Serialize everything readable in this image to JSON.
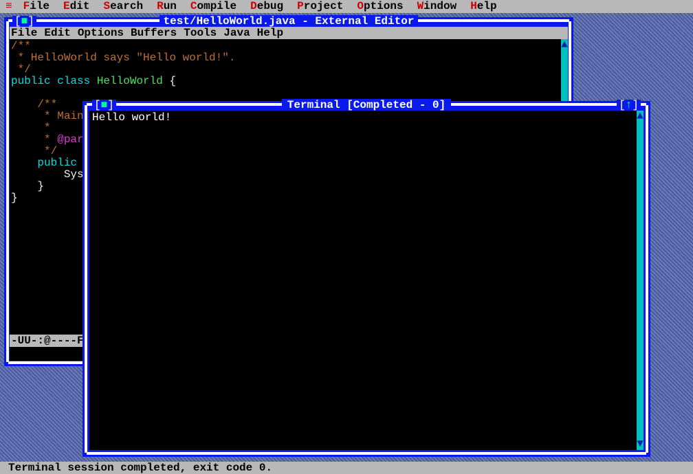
{
  "menubar": {
    "system_glyph": "≡",
    "items": [
      {
        "hotkey": "F",
        "rest": "ile"
      },
      {
        "hotkey": "E",
        "rest": "dit"
      },
      {
        "hotkey": "S",
        "rest": "earch"
      },
      {
        "hotkey": "R",
        "rest": "un"
      },
      {
        "hotkey": "C",
        "rest": "ompile"
      },
      {
        "hotkey": "D",
        "rest": "ebug"
      },
      {
        "hotkey": "P",
        "rest": "roject"
      },
      {
        "hotkey": "O",
        "rest": "ptions"
      },
      {
        "hotkey": "W",
        "rest": "indow"
      },
      {
        "hotkey": "H",
        "rest": "elp"
      }
    ]
  },
  "editor_window": {
    "title": "test/HelloWorld.java - External Editor",
    "close_glyph_l": "[",
    "close_glyph_sq": "■",
    "close_glyph_r": "]",
    "inner_menu": [
      "File",
      "Edit",
      "Options",
      "Buffers",
      "Tools",
      "Java",
      "Help"
    ],
    "code_lines": [
      {
        "cls": "c-doc",
        "text": "/**"
      },
      {
        "cls": "c-doc",
        "text": " * HelloWorld says \"Hello world!\"."
      },
      {
        "cls": "c-doc",
        "text": " */"
      },
      {
        "segments": [
          {
            "cls": "c-kw",
            "text": "public class "
          },
          {
            "cls": "c-cls",
            "text": "HelloWorld"
          },
          {
            "cls": "c-bra",
            "text": " {"
          }
        ]
      },
      {
        "cls": "",
        "text": ""
      },
      {
        "cls": "c-doc",
        "text": "    /**"
      },
      {
        "cls": "c-doc",
        "text": "     * Main"
      },
      {
        "cls": "c-doc",
        "text": "     *"
      },
      {
        "segments": [
          {
            "cls": "c-doc",
            "text": "     * "
          },
          {
            "cls": "c-tag",
            "text": "@par"
          }
        ]
      },
      {
        "cls": "c-doc",
        "text": "     */"
      },
      {
        "cls": "c-kw",
        "text": "    public"
      },
      {
        "cls": "",
        "text": "        Sys"
      },
      {
        "cls": "c-bra",
        "text": "    }"
      },
      {
        "cls": "c-bra",
        "text": "}"
      }
    ],
    "scroll_up": "▲",
    "modeline": "-UU-:@----F"
  },
  "terminal_window": {
    "title": "Terminal [Completed - 0]",
    "close_glyph_l": "[",
    "close_glyph_sq": "■",
    "close_glyph_r": "]",
    "zoom_glyph_l": "[",
    "zoom_glyph_ar": "↑",
    "zoom_glyph_r": "]",
    "output": "Hello world!",
    "scroll_up": "▲",
    "scroll_down": "▼"
  },
  "status": "Terminal session completed, exit code 0."
}
